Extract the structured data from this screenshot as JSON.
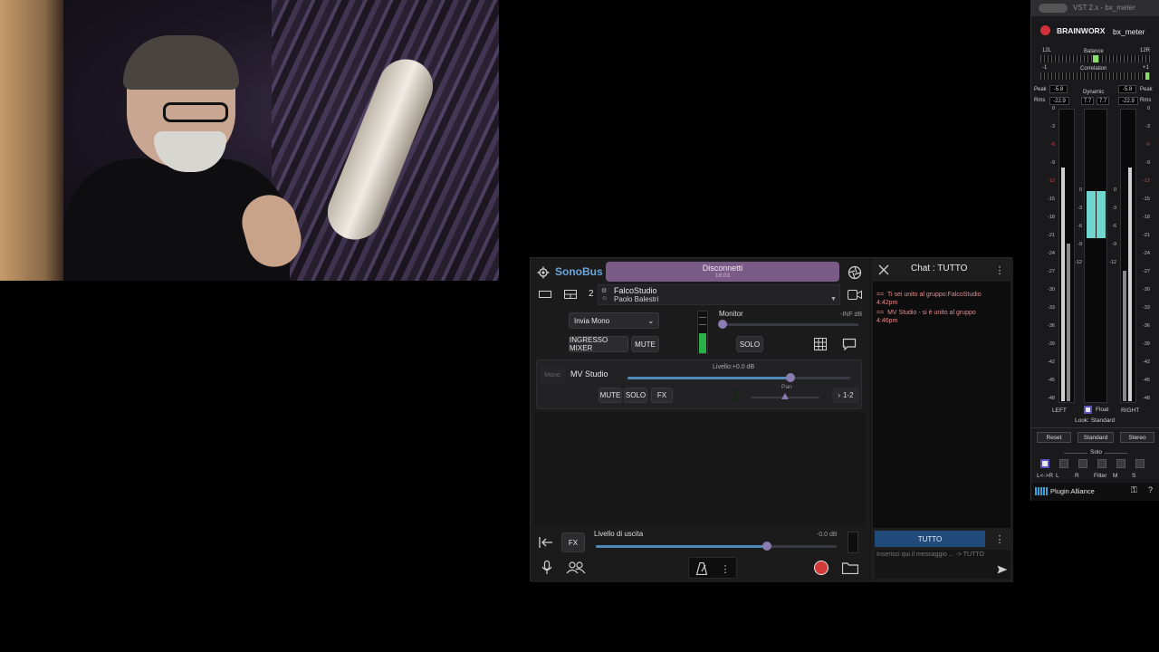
{
  "sonobus": {
    "app_name": "SonoBus",
    "connect_button": {
      "label": "Disconnetti",
      "time": "18:03"
    },
    "group": {
      "user_count": "2",
      "name": "FalcoStudio",
      "user": "Paolo Balestri"
    },
    "send_mode": {
      "selected": "Invia Mono"
    },
    "monitor": {
      "label": "Monitor",
      "value": "-INF dB",
      "level": 0.0
    },
    "ingresso_mixer_label": "INGRESSO MIXER",
    "mute_label": "MUTE",
    "solo_label": "SOLO",
    "peer": {
      "mono_label": "Mono",
      "name": "MV Studio",
      "level_label": "Livello:+0.0 dB",
      "level": 0.73,
      "mute_label": "MUTE",
      "solo_label": "SOLO",
      "fx_label": "FX",
      "pan_label": "Pan",
      "pan": 0.5,
      "channels": "1-2"
    },
    "output": {
      "fx_label": "FX",
      "label": "Livello di uscita",
      "value": "-0.0 dB",
      "level": 0.71
    }
  },
  "chat": {
    "title": "Chat : TUTTO",
    "messages": [
      {
        "prefix": "==",
        "text": "Ti sei unito al gruppo:FalcoStudio",
        "time": "4:42pm"
      },
      {
        "prefix": "==",
        "text": "MV Studio - si è unito al gruppo",
        "time": "4:46pm"
      }
    ],
    "target_button": "TUTTO",
    "input_placeholder": "Inserisci qui il messaggio ... -> TUTTO"
  },
  "bx_meter": {
    "window_title": "VST 2.x - bx_meter",
    "brand": "BRAINWORX",
    "plugin": "bx_meter",
    "balance_label": "Balance",
    "balance_left": "12L",
    "balance_right": "12R",
    "correlation_label": "Correlation",
    "correlation_left": "-1",
    "correlation_right": "+1",
    "peak_label": "Peak",
    "rms_label": "Rms",
    "dynamic_label": "Dynamic",
    "peak_left": "-5.8",
    "peak_right": "-5.8",
    "rms_left": "-22.9",
    "rms_right": "-22.9",
    "dynamic_left": "7.7",
    "dynamic_right": "7.7",
    "scale": [
      "0",
      "-3",
      "-6",
      "-9",
      "-12",
      "-15",
      "-18",
      "-21",
      "-24",
      "-27",
      "-30",
      "-33",
      "-36",
      "-39",
      "-42",
      "-45",
      "-48"
    ],
    "dyn_scale": [
      "0",
      "-3",
      "-6",
      "-9",
      "-12"
    ],
    "left_label": "LEFT",
    "right_label": "RIGHT",
    "float_label": "Float",
    "look_label": "Look: Standard",
    "reset_label": "Reset",
    "standard_label": "Standard",
    "stereo_label": "Stereo",
    "solo_label": "Solo",
    "solo_buttons": [
      "L<->R",
      "L",
      "R",
      "Filter",
      "M",
      "S"
    ],
    "footer": "Plugin Alliance",
    "help": "?",
    "accent": "#6fd6d0"
  }
}
